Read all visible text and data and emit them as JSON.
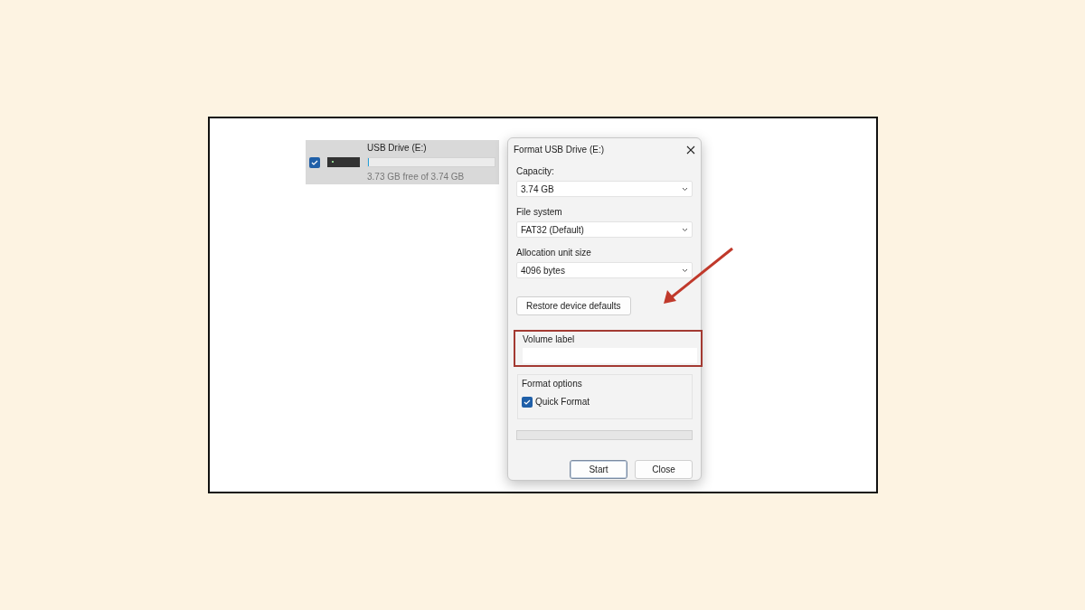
{
  "drive": {
    "selected": true,
    "name": "USB Drive (E:)",
    "level": 0.003,
    "free_text": "3.73 GB free of 3.74 GB"
  },
  "dialog": {
    "title": "Format USB Drive (E:)",
    "fields": [
      {
        "label": "Capacity:",
        "value": "3.74 GB"
      },
      {
        "label": "File system",
        "value": "FAT32 (Default)"
      },
      {
        "label": "Allocation unit size",
        "value": "4096 bytes"
      }
    ],
    "restore_button": "Restore device defaults",
    "volume_label": {
      "label": "Volume label"
    },
    "format_options": {
      "title": "Format options",
      "quick_format": {
        "label": "Quick Format",
        "checked": true
      }
    },
    "progress": {
      "level": 0
    },
    "buttons": [
      {
        "label": "Start",
        "default": true
      },
      {
        "label": "Close",
        "default": false
      }
    ]
  }
}
